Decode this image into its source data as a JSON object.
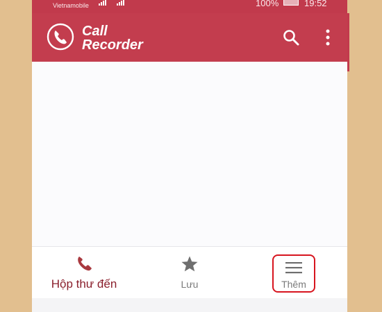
{
  "status_bar": {
    "carrier": "Vietnamobile",
    "battery_percent": "100%",
    "time": "19:52"
  },
  "app_bar": {
    "title_line1": "Call",
    "title_line2": "Recorder",
    "logo_icon": "phone-handset-icon",
    "actions": [
      "search-icon",
      "more-vert-icon"
    ]
  },
  "bottom_nav": {
    "items": [
      {
        "label": "Hộp thư đến",
        "icon": "phone-handset-icon",
        "active": true
      },
      {
        "label": "Lưu",
        "icon": "star-icon",
        "active": false
      },
      {
        "label": "Thêm",
        "icon": "menu-icon",
        "active": false,
        "highlighted": true
      }
    ]
  },
  "colors": {
    "app_bar": "#c33d4e",
    "status_bar": "#c13a4c",
    "active_tab": "#8a1f2c",
    "inactive_tab": "#7a7a7a",
    "highlight_box": "#d7141e",
    "outside_background": "#e2bf8f"
  }
}
